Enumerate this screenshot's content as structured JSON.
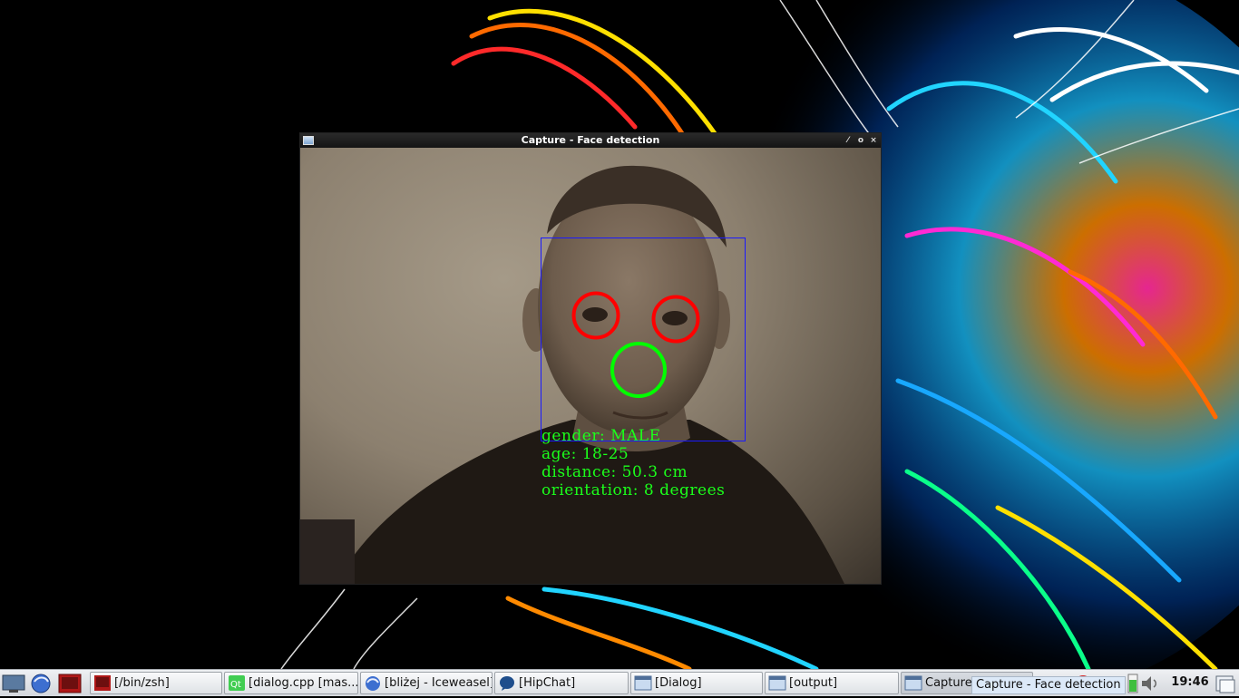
{
  "window": {
    "title": "Capture - Face detection",
    "controls": {
      "minimize": "⁄",
      "maximize": "o",
      "close": "×"
    }
  },
  "detection": {
    "gender_line": "gender: MALE",
    "age_line": "age: 18-25",
    "distance_line": "distance: 50.3 cm",
    "orientation_line": "orientation: 8 degrees",
    "colors": {
      "face_box": "#1a1aff",
      "eyes": "#ff0000",
      "nose": "#00ff00",
      "text": "#1bff1b"
    }
  },
  "taskbar": {
    "launchers": [
      "show-desktop-icon",
      "browser-icon",
      "terminal-icon"
    ],
    "tasks": [
      {
        "label": "[/bin/zsh]",
        "icon": "terminal-icon"
      },
      {
        "label": "[dialog.cpp [mas...",
        "icon": "qt-creator-icon"
      },
      {
        "label": "[bliżej - Iceweasel]",
        "icon": "browser-icon"
      },
      {
        "label": "[HipChat]",
        "icon": "chat-icon"
      },
      {
        "label": "[Dialog]",
        "icon": "window-icon"
      },
      {
        "label": "[output]",
        "icon": "window-icon"
      },
      {
        "label": "Capture",
        "icon": "window-icon"
      }
    ],
    "tooltip": "Capture - Face detection",
    "clock": "19:46"
  }
}
